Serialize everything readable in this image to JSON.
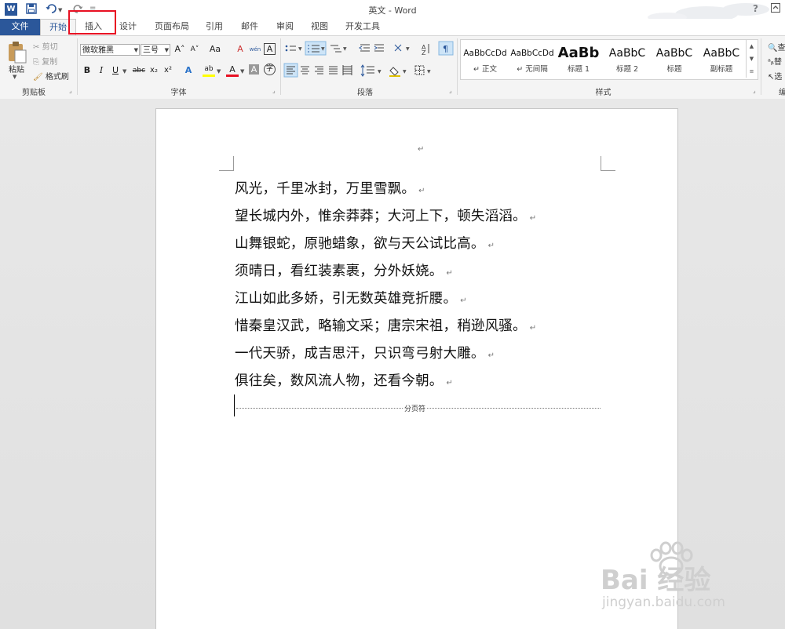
{
  "window": {
    "title": "英文 - Word",
    "help": "?",
    "restore": "⧉"
  },
  "qat": {
    "app_icon": "W",
    "save": "💾",
    "undo": "↶",
    "redo": "↻",
    "more": "="
  },
  "tabs": [
    "文件",
    "开始",
    "插入",
    "设计",
    "页面布局",
    "引用",
    "邮件",
    "审阅",
    "视图",
    "开发工具"
  ],
  "clipboard": {
    "paste": "粘贴",
    "cut": "剪切",
    "copy": "复制",
    "format_painter": "格式刷",
    "group": "剪贴板"
  },
  "font": {
    "name": "微软雅黑",
    "size": "三号",
    "grow": "A˄",
    "shrink": "A˅",
    "case": "Aa",
    "clear": "A",
    "phonetic": "wén",
    "border_char": "A",
    "bold": "B",
    "italic": "I",
    "underline": "U",
    "strike": "abc",
    "sub": "x₂",
    "sup": "x²",
    "effects": "A",
    "highlight": "ab",
    "color": "A",
    "shade": "A",
    "enclose": "字",
    "group": "字体"
  },
  "paragraph": {
    "group": "段落"
  },
  "styles": {
    "items": [
      {
        "preview": "AaBbCcDd",
        "name": "↵ 正文"
      },
      {
        "preview": "AaBbCcDd",
        "name": "↵ 无间隔"
      },
      {
        "preview": "AaBb",
        "name": "标题 1"
      },
      {
        "preview": "AaBbC",
        "name": "标题 2"
      },
      {
        "preview": "AaBbC",
        "name": "标题"
      },
      {
        "preview": "AaBbC",
        "name": "副标题"
      }
    ],
    "group": "样式"
  },
  "editing": {
    "find": "查",
    "replace": "替",
    "select": "选",
    "group": "编"
  },
  "document": {
    "top_mark": "↵",
    "lines": [
      "风光，千里冰封，万里雪飘。",
      "望长城内外，惟余莽莽；大河上下，顿失滔滔。",
      "山舞银蛇，原驰蜡象，欲与天公试比高。",
      "须晴日，看红装素裹，分外妖娆。",
      "江山如此多娇，引无数英雄竞折腰。",
      "惜秦皇汉武，略输文采；唐宗宋祖，稍逊风骚。",
      "一代天骄，成吉思汗，只识弯弓射大雕。",
      "俱往矣，数风流人物，还看今朝。"
    ],
    "para_mark": "↵",
    "page_break_label": "分页符"
  },
  "watermark": {
    "brand": "Bai  经验",
    "url": "jingyan.baidu.com"
  },
  "colors": {
    "accent": "#2b579a",
    "highlight_box": "#e81123"
  }
}
